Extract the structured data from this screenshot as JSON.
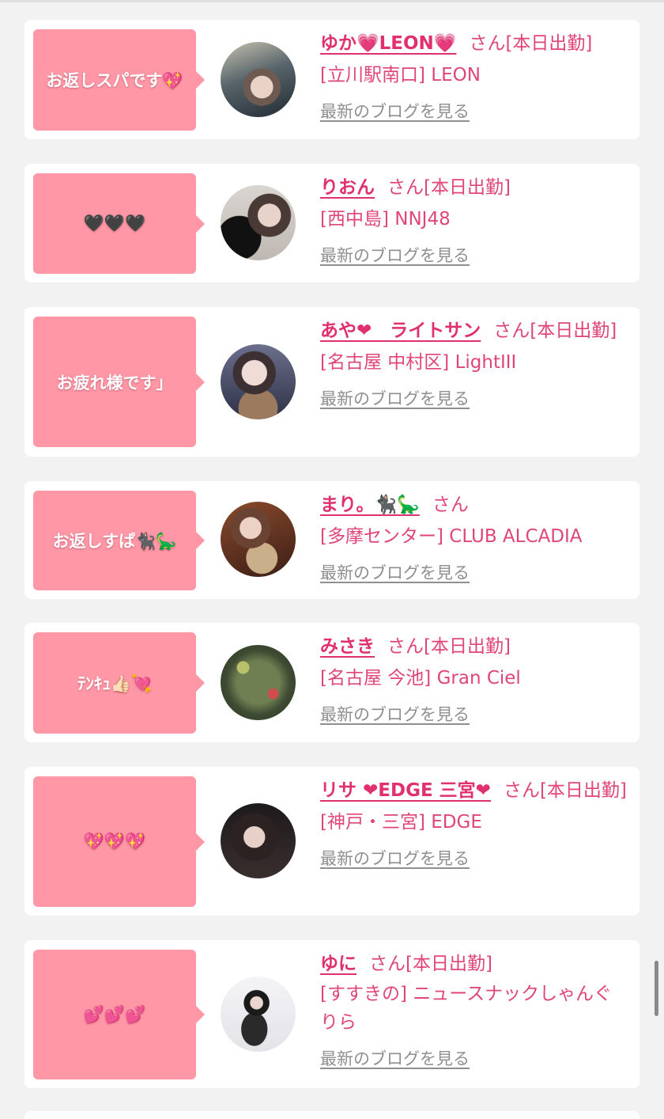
{
  "blog_link_label": "最新のブログを見る",
  "cards": [
    {
      "message": "お返しスパです💖",
      "name": "ゆか💗LEON💗",
      "suffix": "さん[本日出勤]",
      "shop": "[立川駅南口] LEON"
    },
    {
      "message": "🖤🖤🖤",
      "name": "りおん",
      "suffix": "さん[本日出勤]",
      "shop": "[西中島] NNJ48"
    },
    {
      "message": "お疲れ様です」",
      "name": "あや❤︎　ライトサン",
      "suffix": "さん[本日出勤]",
      "shop": "[名古屋 中村区] LightIII"
    },
    {
      "message": "お返しすぱ🐈‍⬛🦕",
      "name": "まり。🐈‍⬛🦕",
      "suffix": "さん",
      "shop": "[多摩センター] CLUB ALCADIA"
    },
    {
      "message": "ﾃﾝｷｭ👍🏻💘",
      "name": "みさき",
      "suffix": "さん[本日出勤]",
      "shop": "[名古屋 今池] Gran Ciel"
    },
    {
      "message": "💖💖💖",
      "name": "リサ ❤︎EDGE 三宮❤︎",
      "suffix": "さん[本日出勤]",
      "shop": "[神戸・三宮] EDGE"
    },
    {
      "message": "💕💕💕",
      "name": "ゆに",
      "suffix": "さん[本日出勤]",
      "shop": "[すすきの] ニュースナックしゃんぐりら"
    }
  ]
}
